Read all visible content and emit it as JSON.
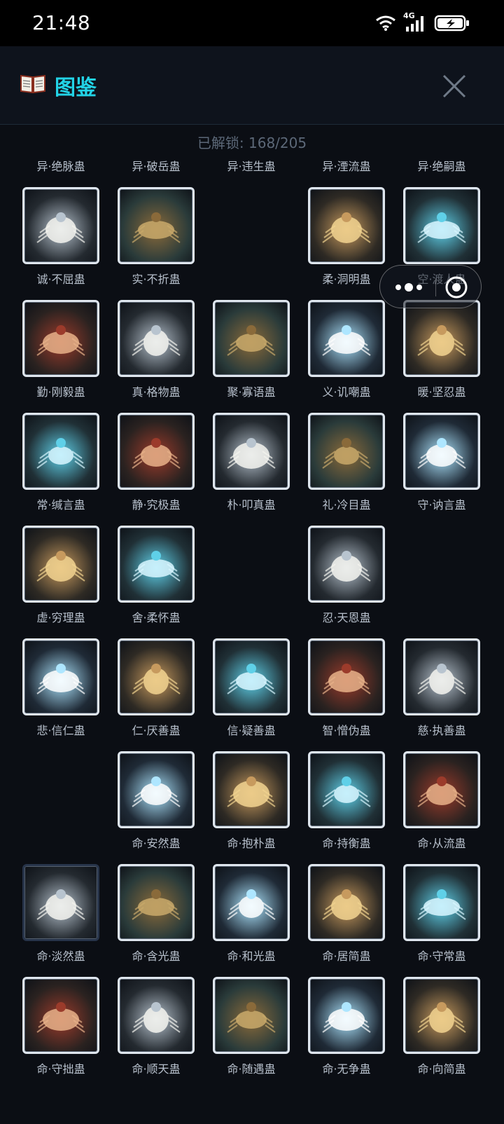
{
  "status_bar": {
    "time": "21:48",
    "network": "4G"
  },
  "header": {
    "title": "图鉴",
    "book_icon": "book-icon",
    "close_icon": "close-icon"
  },
  "unlock_text": "已解锁: 168/205",
  "colors": {
    "accent": "#22d3e6",
    "background": "#0b0e14",
    "header": "#0e131c",
    "card_border": "#dfe6ee",
    "gold_border": "#8f7132"
  },
  "rows": [
    [
      "异·绝脉蛊",
      "异·破岳蛊",
      "异·违生蛊",
      "异·湮流蛊",
      "异·绝嗣蛊"
    ],
    [
      "诚·不屈蛊",
      "实·不折蛊",
      "",
      "柔·洞明蛊",
      "空·渡人蛊"
    ],
    [
      "勤·刚毅蛊",
      "真·格物蛊",
      "聚·寡语蛊",
      "义·讥嘲蛊",
      "暖·坚忍蛊"
    ],
    [
      "常·缄言蛊",
      "静·究极蛊",
      "朴·叩真蛊",
      "礼·冷目蛊",
      "守·讷言蛊"
    ],
    [
      "虚·穷理蛊",
      "舍·柔怀蛊",
      "",
      "忍·天恩蛊",
      ""
    ],
    [
      "悲·信仁蛊",
      "仁·厌善蛊",
      "信·疑善蛊",
      "智·憎伪蛊",
      "慈·执善蛊"
    ],
    [
      "",
      "命·安然蛊",
      "命·抱朴蛊",
      "命·持衡蛊",
      "命·从流蛊"
    ],
    [
      "命·淡然蛊",
      "命·含光蛊",
      "命·和光蛊",
      "命·居简蛊",
      "命·守常蛊"
    ],
    [
      "命·守拙蛊",
      "命·顺天蛊",
      "命·随遇蛊",
      "命·无争蛊",
      "命·向简蛊"
    ]
  ],
  "capsule": {
    "more_icon": "more-dots-icon",
    "close_icon": "target-circle-icon"
  }
}
